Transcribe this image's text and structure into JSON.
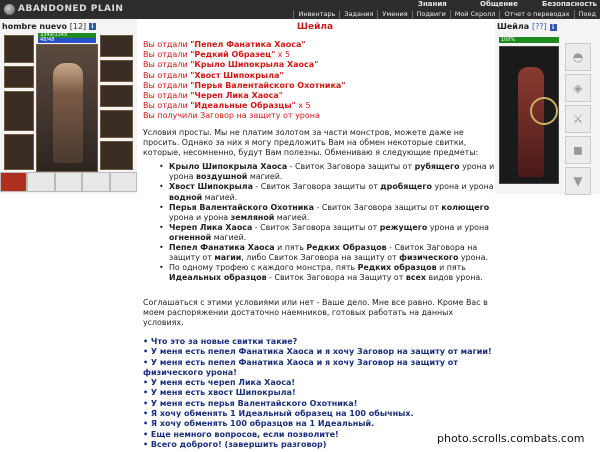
{
  "app": {
    "logo": "ABANDONED PLAIN"
  },
  "nav": {
    "top": [
      "Знания",
      "Общение",
      "Безопасность"
    ],
    "bottom": [
      "Инвентарь",
      "Задания",
      "Умения",
      "Подвиги",
      "Мой Скролл",
      "Отчет о переводах",
      "Поед"
    ]
  },
  "player": {
    "name": "hombre nuevo",
    "level": "[12]",
    "info": "i",
    "hp": "3349/3349",
    "mp": "48/48"
  },
  "npc": {
    "name": "Шейла",
    "help": "[??]",
    "info": "i",
    "hp": "100%"
  },
  "dialog": {
    "title": "Шейла",
    "given": [
      {
        "label": "Вы отдали ",
        "item": "\"Пепел Фанатика Хаоса\"",
        "count": ""
      },
      {
        "label": "Вы отдали ",
        "item": "\"Редкий Образец\"",
        "count": " x 5"
      },
      {
        "label": "Вы отдали ",
        "item": "\"Крыло Шипокрыла Хаоса\"",
        "count": ""
      },
      {
        "label": "Вы отдали ",
        "item": "\"Хвост Шипокрыла\"",
        "count": ""
      },
      {
        "label": "Вы отдали ",
        "item": "\"Перья Валентайского Охотника\"",
        "count": ""
      },
      {
        "label": "Вы отдали ",
        "item": "\"Череп Лика Хаоса\"",
        "count": ""
      },
      {
        "label": "Вы отдали ",
        "item": "\"Идеальные Образцы\"",
        "count": " x 5"
      }
    ],
    "received": "Вы получили Заговор на защиту от урона",
    "intro": "Условия просты. Мы не платим золотом за части монстров, можете даже не просить. Однако за них я могу предложить Вам на обмен некоторые свитки, которые, несомненно, будут Вам полезны. Обмениваю я следующие предметы:",
    "terms": [
      {
        "a": "Крыло Шипокрыла Хаоса",
        "b": " - Свиток Заговора защиты от ",
        "c": "рубящего",
        "d": " урона и урона ",
        "e": "воздушной",
        "f": " магией."
      },
      {
        "a": "Хвост Шипокрыла",
        "b": " - Свиток Заговора защиты от ",
        "c": "дробящего",
        "d": " урона и урона ",
        "e": "водной",
        "f": " магией."
      },
      {
        "a": "Перья Валентайского Охотника",
        "b": " - Свиток Заговора защиты от ",
        "c": "колющего",
        "d": " урона и урона ",
        "e": "земляной",
        "f": " магией."
      },
      {
        "a": "Череп Лика Хаоса",
        "b": " - Свиток Заговора защиты от ",
        "c": "режущего",
        "d": " урона и урона ",
        "e": "огненной",
        "f": " магией."
      }
    ],
    "term5": {
      "a": "Пепел Фанатика Хаоса",
      "b": " и пять ",
      "c": "Редких Образцов",
      "d": " - Свиток Заговора на защиту от ",
      "e": "магии",
      "f": ", либо Свиток Заговора на защиту от ",
      "g": "физического",
      "h": " урона."
    },
    "term6": {
      "a": "По одному трофею с каждого монстра, пять ",
      "b": "Редких образцов",
      "c": " и пять ",
      "d": "Идеальных образцов",
      "e": " - Свиток Заговора на Защиту от ",
      "f": "всех",
      "g": " видов урона."
    },
    "agree": "Соглашаться с этими условиями или нет - Ваше дело. Мне все равно. Кроме Вас в моем распоряжении достаточно наемников, готовых работать на данных условиях.",
    "answers": [
      "• Что это за новые свитки такие?",
      "• У меня есть пепел Фанатика Хаоса и я хочу Заговор на защиту от магии!",
      "• У меня есть пепел Фанатика Хаоса и я хочу Заговор на защиту от физического урона!",
      "• У меня есть череп Лика Хаоса!",
      "• У меня есть хвост Шипокрыла!",
      "• У меня есть перья Валентайского Охотника!",
      "• Я хочу обменять 1 Идеальный образец на 100 обычных.",
      "• Я хочу обменять 100 образцов на 1 Идеальный.",
      "• Еще немного вопросов, если позволите!",
      "• Всего доброго! (завершить разговор)"
    ]
  },
  "watermark": "photo.scrolls.combats.com"
}
